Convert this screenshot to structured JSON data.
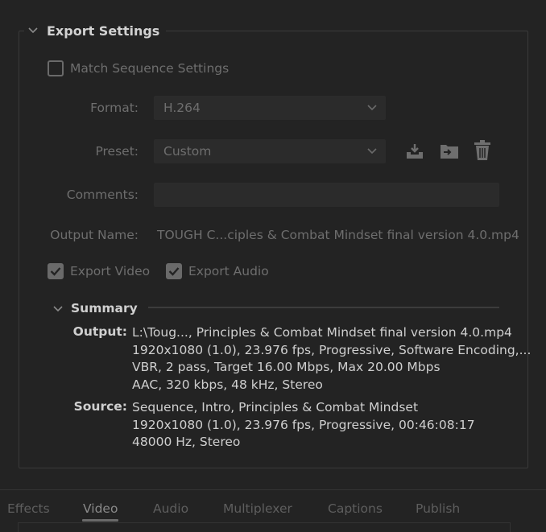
{
  "section": {
    "title": "Export Settings"
  },
  "match_sequence": {
    "label": "Match Sequence Settings",
    "checked": false
  },
  "format": {
    "label": "Format:",
    "value": "H.264"
  },
  "preset": {
    "label": "Preset:",
    "value": "Custom",
    "icons": [
      "import-preset-icon",
      "save-preset-icon",
      "delete-preset-icon"
    ]
  },
  "comments": {
    "label": "Comments:",
    "value": ""
  },
  "output_name": {
    "label": "Output Name:",
    "value": "TOUGH C...ciples & Combat Mindset final version 4.0.mp4"
  },
  "export_video": {
    "label": "Export Video",
    "checked": true
  },
  "export_audio": {
    "label": "Export Audio",
    "checked": true
  },
  "summary": {
    "title": "Summary",
    "output_label": "Output:",
    "output_lines": [
      "L:\\Toug..., Principles & Combat Mindset final version 4.0.mp4",
      "1920x1080 (1.0), 23.976 fps, Progressive, Software Encoding,...",
      "VBR, 2 pass, Target 16.00 Mbps, Max 20.00 Mbps",
      "AAC, 320 kbps, 48 kHz, Stereo"
    ],
    "source_label": "Source:",
    "source_lines": [
      "Sequence, Intro, Principles & Combat Mindset",
      "1920x1080 (1.0), 23.976 fps, Progressive, 00:46:08:17",
      "48000 Hz, Stereo"
    ]
  },
  "tabs": [
    {
      "label": "Effects",
      "active": false
    },
    {
      "label": "Video",
      "active": true
    },
    {
      "label": "Audio",
      "active": false
    },
    {
      "label": "Multiplexer",
      "active": false
    },
    {
      "label": "Captions",
      "active": false
    },
    {
      "label": "Publish",
      "active": false
    }
  ]
}
